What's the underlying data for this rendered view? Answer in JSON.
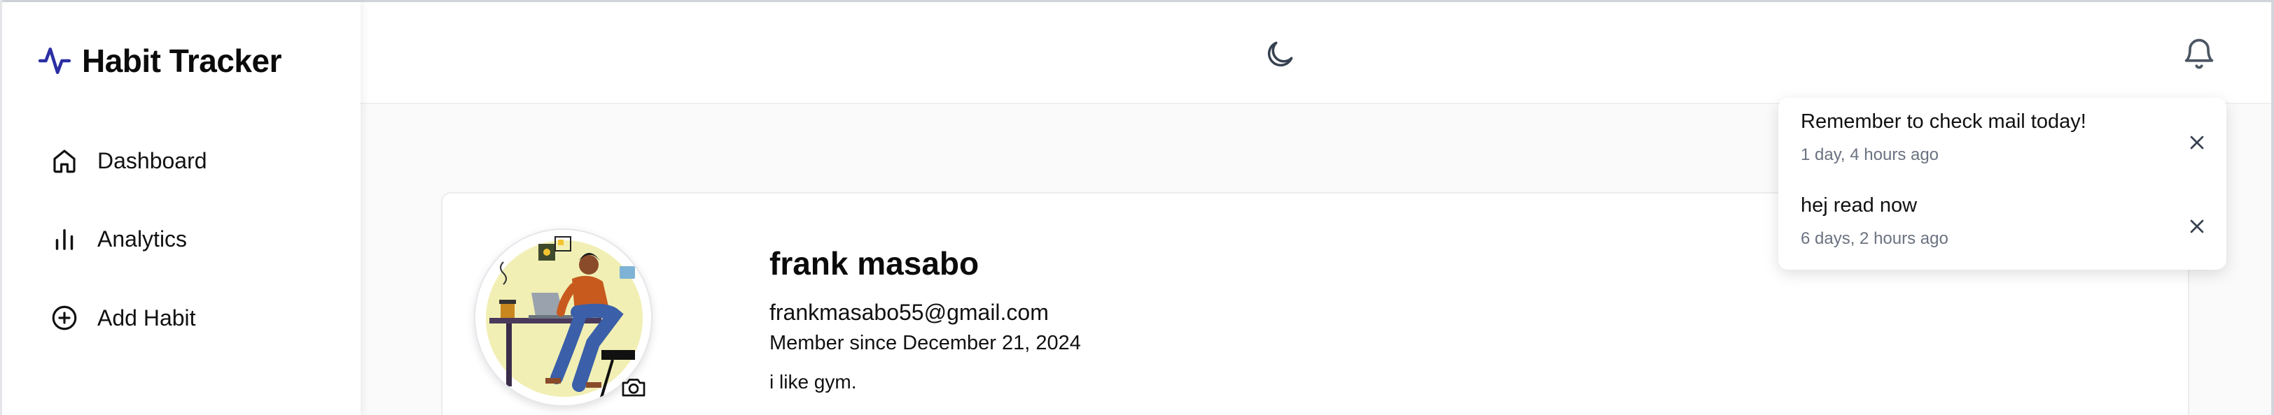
{
  "app": {
    "title": "Habit Tracker",
    "logo_icon": "activity-pulse-icon",
    "accent_color": "#2b2fa3"
  },
  "sidebar": {
    "items": [
      {
        "label": "Dashboard",
        "icon": "home-icon"
      },
      {
        "label": "Analytics",
        "icon": "bar-chart-icon"
      },
      {
        "label": "Add Habit",
        "icon": "plus-circle-icon"
      }
    ]
  },
  "header": {
    "theme_toggle_icon": "moon-icon",
    "notifications_icon": "bell-icon"
  },
  "notifications": [
    {
      "title": "Remember to check mail today!",
      "time": "1 day, 4 hours ago",
      "dismiss_icon": "close-icon"
    },
    {
      "title": "hej read now",
      "time": "6 days, 2 hours ago",
      "dismiss_icon": "close-icon"
    }
  ],
  "profile": {
    "name": "frank masabo",
    "email": "frankmasabo55@gmail.com",
    "member_since": "Member since December 21, 2024",
    "bio": "i like gym.",
    "avatar": "illustration-person-at-laptop",
    "camera_icon": "camera-icon"
  }
}
